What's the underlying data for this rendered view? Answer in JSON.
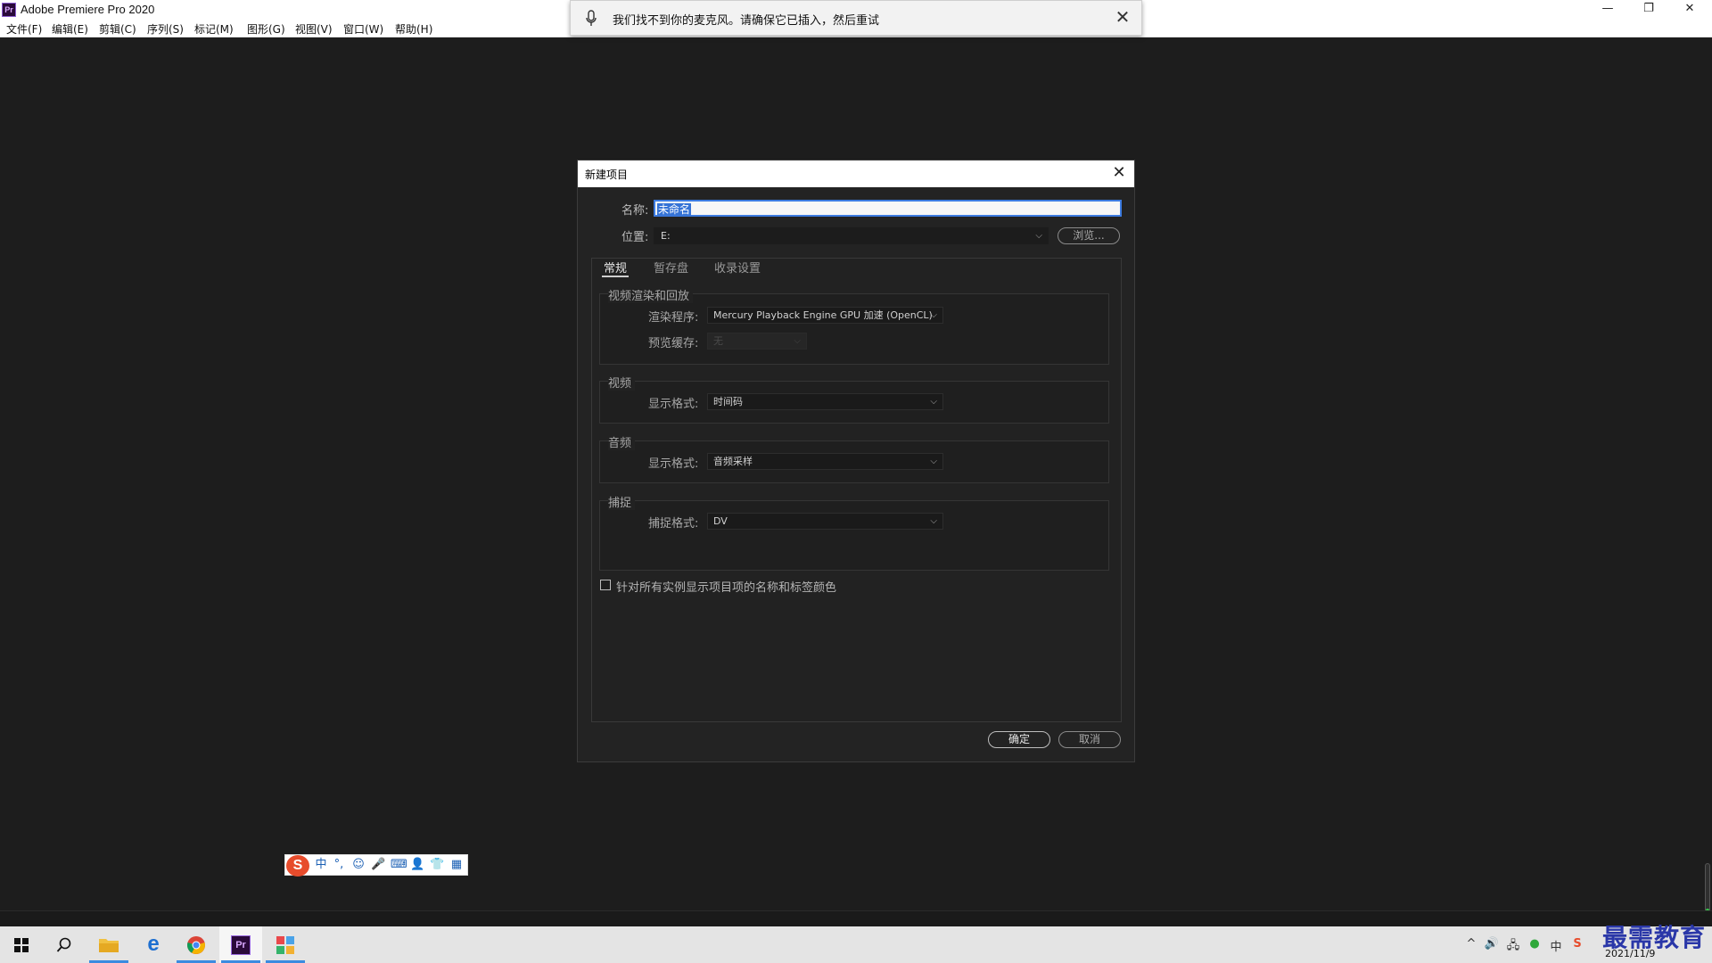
{
  "window": {
    "app_icon_text": "Pr",
    "title": "Adobe Premiere Pro 2020",
    "minimize": "—",
    "restore": "❐",
    "close": "✕"
  },
  "menu": [
    "文件(F)",
    "编辑(E)",
    "剪辑(C)",
    "序列(S)",
    "标记(M)",
    "图形(G)",
    "视图(V)",
    "窗口(W)",
    "帮助(H)"
  ],
  "notification": {
    "message": "我们找不到你的麦克风。请确保它已插入，然后重试",
    "close": "✕"
  },
  "dialog": {
    "title": "新建项目",
    "close": "✕",
    "name_label": "名称:",
    "name_value": "未命名",
    "location_label": "位置:",
    "location_value": "E:",
    "browse_button": "浏览...",
    "tabs": [
      "常规",
      "暂存盘",
      "收录设置"
    ],
    "active_tab": "常规",
    "groups": {
      "render": {
        "title": "视频渲染和回放",
        "renderer_label": "渲染程序:",
        "renderer_value": "Mercury Playback Engine GPU 加速 (OpenCL)",
        "preview_cache_label": "预览缓存:",
        "preview_cache_value": "无"
      },
      "video": {
        "title": "视频",
        "display_format_label": "显示格式:",
        "display_format_value": "时间码"
      },
      "audio": {
        "title": "音频",
        "display_format_label": "显示格式:",
        "display_format_value": "音频采样"
      },
      "capture": {
        "title": "捕捉",
        "capture_format_label": "捕捉格式:",
        "capture_format_value": "DV"
      }
    },
    "checkbox_label": "针对所有实例显示项目项的名称和标签颜色",
    "checkbox_checked": false,
    "ok_button": "确定",
    "cancel_button": "取消"
  },
  "ime": {
    "logo": "S",
    "mode": "中",
    "punct": "°,",
    "icons": [
      "☺",
      "🎤",
      "⌨",
      "👤",
      "👕",
      "▦"
    ]
  },
  "taskbar": {
    "pinned": [
      "windows-start",
      "search",
      "file-explorer",
      "edge",
      "chrome",
      "premiere-pro",
      "photo-app"
    ],
    "premiere_label": "Pr",
    "date": "2021/11/9",
    "tray": [
      "^",
      "🔊",
      "🖧",
      "●",
      "中",
      "S"
    ],
    "accent": "#3b8be0"
  },
  "watermark": "最需教育"
}
